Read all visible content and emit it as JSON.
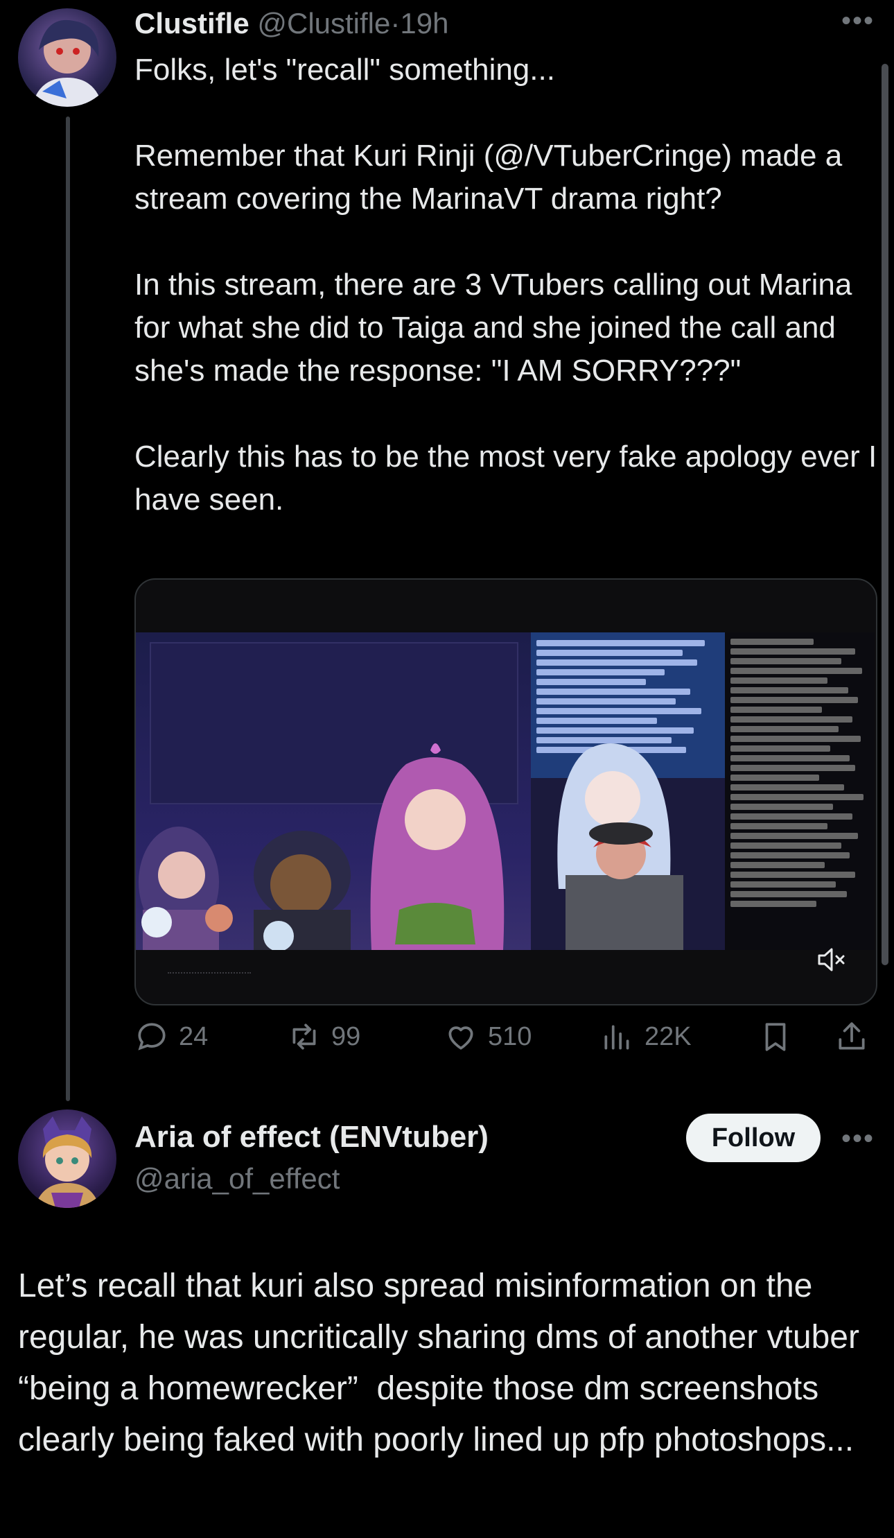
{
  "tweet1": {
    "display_name": "Clustifle",
    "handle": "@Clustifle",
    "separator": "·",
    "time": "19h",
    "text": "Folks, let's \"recall\" something...\n\nRemember that Kuri Rinji (@/VTuberCringe) made a stream covering the MarinaVT drama right?\n\nIn this stream, there are 3 VTubers calling out Marina for what she did to Taiga and she joined the call and she's made the response: \"I AM SORRY???\"\n\nClearly this has to be the most very fake apology ever I have seen.",
    "video": {
      "muted_icon": "speaker-muted-icon"
    },
    "actions": {
      "replies": "24",
      "reposts": "99",
      "likes": "510",
      "views": "22K"
    }
  },
  "tweet2": {
    "display_name": "Aria of effect (ENVtuber)",
    "handle": "@aria_of_effect",
    "follow_label": "Follow",
    "text": "Let’s recall that kuri also spread misinformation on the regular, he was uncritically sharing dms of another vtuber “being a homewrecker”  despite those dm screenshots clearly being faked with poorly lined up pfp photoshops..."
  },
  "colors": {
    "background": "#000000",
    "text": "#e7e9ea",
    "muted": "#71767b",
    "border": "#2f3336"
  }
}
